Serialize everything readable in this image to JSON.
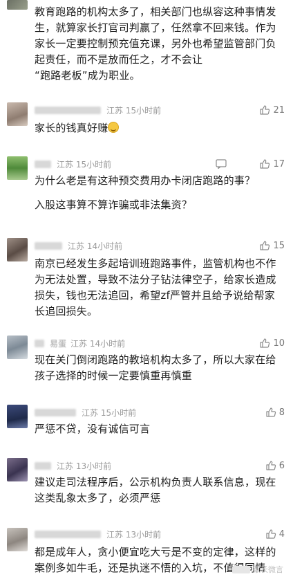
{
  "comments": [
    {
      "text_lines": [
        "教育跑路的机构太多了，相关部门也纵容这种事情发生，就算家长打官司判赢了，任然拿不回来钱。作为家长一定要控制预充值充课，另外也希望监管部门负起责任，而不是放而任之，才不会让",
        "“跑路老板”成为职业。"
      ]
    },
    {
      "location_time": "江苏 15小时前",
      "likes": "21",
      "text": "家长的钱真好赚",
      "emoji": "grinning-sweat-emoji"
    },
    {
      "location_time": "江苏 15小时前",
      "likes": "17",
      "text_p1": "为什么老是有这种预交费用办卡闭店跑路的事？",
      "text_p2": "入股这事算不算诈骗或非法集资？"
    },
    {
      "location_time": "江苏 14小时前",
      "likes": "15",
      "text": "南京已经发生多起培训班跑路事件，监管机构也不作为无法处置，导致不法分子钻法律空子，给家长造成损失，钱也无法追回，希望zf严管并且给予说给帮家长追回损失。"
    },
    {
      "name": "易蛋",
      "location_time": "江苏 14小时前",
      "likes": "10",
      "text": "现在关门倒闭跑路的教培机构太多了，所以大家在给孩子选择的时候一定要慎重再慎重"
    },
    {
      "location_time": "江苏 15小时前",
      "likes": "8",
      "text": "严惩不贷，没有诚信可言"
    },
    {
      "location_time": "江苏 13小时前",
      "likes": "6",
      "text": "建议走司法程序后，公示机构负责人联系信息，现在这类乱象太多了，必须严惩"
    },
    {
      "location_time": "江苏 13小时前",
      "likes": "4",
      "text": "都是成年人，贪小便宜吃大亏是不变的定律，这样的案例多如牛毛，还是执迷不悟的入坑，不值得同情"
    }
  ],
  "watermark": "家长微言",
  "colors": {
    "text": "#1f1f1f",
    "meta": "#9a9a9a",
    "like": "#777777"
  },
  "icons": {
    "like": "thumbs-up-icon",
    "reply": "comment-bubble-icon"
  }
}
